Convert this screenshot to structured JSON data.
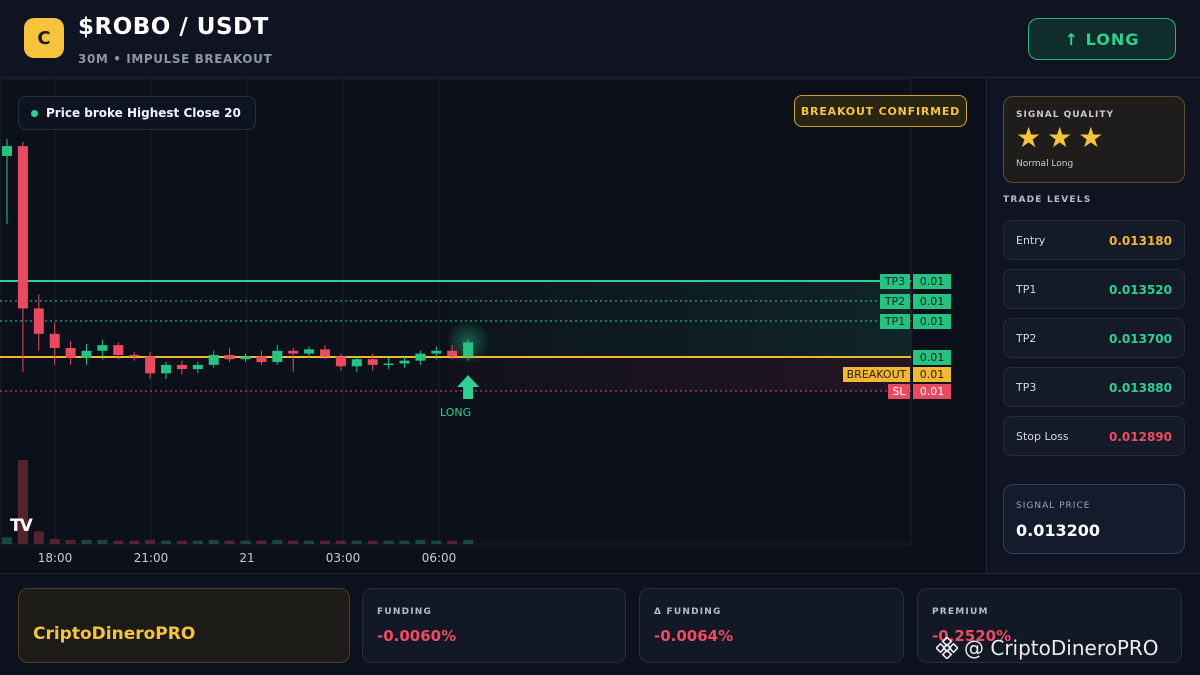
{
  "header": {
    "coin_letter": "C",
    "pair": "$ROBO / USDT",
    "subtitle": "30M • IMPULSE BREAKOUT",
    "signal_button": "↑ LONG"
  },
  "chart": {
    "message": "Price broke Highest Close 20",
    "confirm_badge": "BREAKOUT CONFIRMED",
    "tv_logo": "TV",
    "long_marker_label": "LONG",
    "level_tags": [
      {
        "name": "TP3",
        "value": "0.01"
      },
      {
        "name": "TP2",
        "value": "0.01"
      },
      {
        "name": "TP1",
        "value": "0.01"
      },
      {
        "name": "",
        "value": "0.01"
      },
      {
        "name": "BREAKOUT",
        "value": "0.01"
      },
      {
        "name": "SL",
        "value": "0.01"
      }
    ],
    "x_ticks": [
      "18:00",
      "21:00",
      "21",
      "03:00",
      "06:00"
    ],
    "colors": {
      "up": "#26c281",
      "down": "#ea4a5f",
      "breakout": "#f2b733"
    }
  },
  "chart_data": {
    "type": "candlestick",
    "x_labels": [
      "18:00",
      "21:00",
      "21",
      "03:00",
      "06:00"
    ],
    "levels": {
      "TP3": 0.01,
      "TP2": 0.01,
      "TP1": 0.01,
      "Entry": 0.01,
      "BREAKOUT": 0.01,
      "SL": 0.01
    },
    "candles_ohlc": [
      [
        0.01388,
        0.014,
        0.0134,
        0.01395
      ],
      [
        0.01395,
        0.01398,
        0.01235,
        0.0128
      ],
      [
        0.0128,
        0.0129,
        0.0125,
        0.01262
      ],
      [
        0.01262,
        0.0127,
        0.0124,
        0.01252
      ],
      [
        0.01252,
        0.01257,
        0.0124,
        0.01245
      ],
      [
        0.01245,
        0.01255,
        0.0124,
        0.0125
      ],
      [
        0.0125,
        0.01258,
        0.01244,
        0.01254
      ],
      [
        0.01254,
        0.01256,
        0.01244,
        0.01247
      ],
      [
        0.01247,
        0.01249,
        0.01243,
        0.01246
      ],
      [
        0.01246,
        0.01249,
        0.0123,
        0.01234
      ],
      [
        0.01234,
        0.01242,
        0.0123,
        0.0124
      ],
      [
        0.0124,
        0.01243,
        0.01233,
        0.01237
      ],
      [
        0.01237,
        0.01242,
        0.01234,
        0.0124
      ],
      [
        0.0124,
        0.0125,
        0.01238,
        0.01247
      ],
      [
        0.01247,
        0.01252,
        0.01242,
        0.01244
      ],
      [
        0.01244,
        0.01248,
        0.01242,
        0.01246
      ],
      [
        0.01246,
        0.0125,
        0.0124,
        0.01242
      ],
      [
        0.01242,
        0.01254,
        0.0124,
        0.0125
      ],
      [
        0.0125,
        0.01252,
        0.01235,
        0.01248
      ],
      [
        0.01248,
        0.01253,
        0.01245,
        0.01251
      ],
      [
        0.01251,
        0.01254,
        0.01244,
        0.01246
      ],
      [
        0.01246,
        0.01248,
        0.01236,
        0.01239
      ],
      [
        0.01239,
        0.01246,
        0.01235,
        0.01244
      ],
      [
        0.01244,
        0.01248,
        0.01236,
        0.0124
      ],
      [
        0.0124,
        0.01245,
        0.01237,
        0.01241
      ],
      [
        0.01241,
        0.01246,
        0.01238,
        0.01243
      ],
      [
        0.01243,
        0.0125,
        0.0124,
        0.01248
      ],
      [
        0.01248,
        0.01253,
        0.01244,
        0.0125
      ],
      [
        0.0125,
        0.01254,
        0.01244,
        0.01246
      ],
      [
        0.01246,
        0.01258,
        0.01243,
        0.01256
      ]
    ],
    "volume": [
      0.08,
      1.0,
      0.15,
      0.06,
      0.05,
      0.05,
      0.05,
      0.04,
      0.04,
      0.05,
      0.04,
      0.04,
      0.04,
      0.05,
      0.04,
      0.04,
      0.04,
      0.05,
      0.04,
      0.04,
      0.04,
      0.04,
      0.04,
      0.04,
      0.04,
      0.04,
      0.05,
      0.04,
      0.04,
      0.05
    ]
  },
  "side": {
    "quality_title": "SIGNAL QUALITY",
    "stars": 3,
    "star_glyph": "★",
    "quality_sub": "Normal Long",
    "levels_title": "TRADE LEVELS",
    "levels": [
      {
        "name": "Entry",
        "value": "0.013180",
        "color": "#f5b731"
      },
      {
        "name": "TP1",
        "value": "0.013520",
        "color": "#2ed18f"
      },
      {
        "name": "TP2",
        "value": "0.013700",
        "color": "#2ed18f"
      },
      {
        "name": "TP3",
        "value": "0.013880",
        "color": "#2ed18f"
      },
      {
        "name": "Stop Loss",
        "value": "0.012890",
        "color": "#ef4b60"
      }
    ],
    "signal_price_label": "SIGNAL PRICE",
    "signal_price": "0.013200"
  },
  "footer": {
    "brand": "CriptoDineroPRO",
    "metrics": [
      {
        "label": "FUNDING",
        "value": "-0.0060%"
      },
      {
        "label": "Δ FUNDING",
        "value": "-0.0064%"
      },
      {
        "label": "PREMIUM",
        "value": "-0.2520%"
      }
    ],
    "watermark": "@ CriptoDineroPRO"
  }
}
